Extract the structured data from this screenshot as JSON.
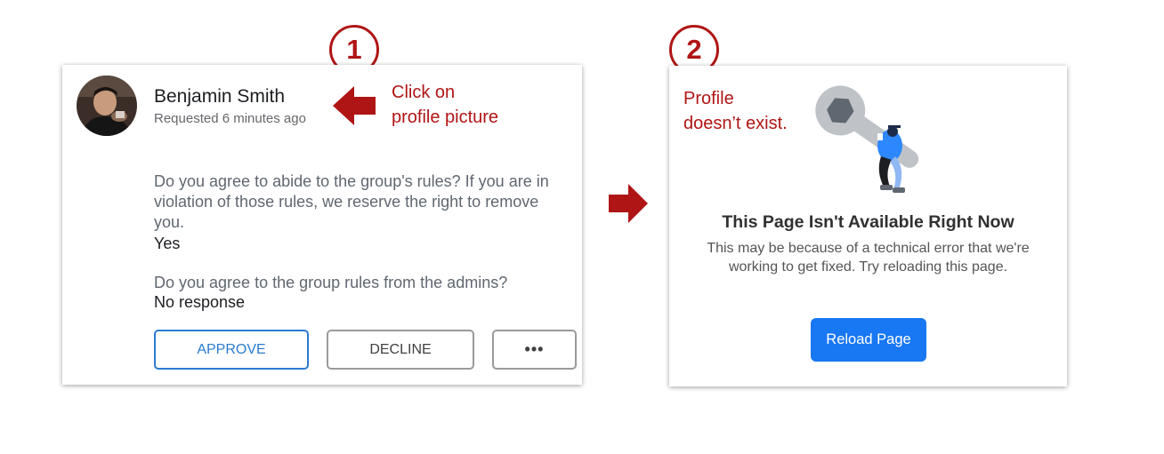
{
  "annotations": {
    "step1_number": "1",
    "step1_text": [
      "Click on",
      "profile picture"
    ],
    "step2_number": "2",
    "step2_text": [
      "Profile",
      "doesn’t exist."
    ]
  },
  "request_card": {
    "name": "Benjamin Smith",
    "requested": "Requested 6 minutes ago",
    "question1": "Do you agree to abide to the group's rules? If you are in violation of those rules, we reserve the right to remove you.",
    "answer1": "Yes",
    "question2": "Do you agree to the group rules from the admins?",
    "answer2": "No response",
    "approve_label": "APPROVE",
    "decline_label": "DECLINE",
    "more_label": "•••"
  },
  "error_page": {
    "title": "This Page Isn't Available Right Now",
    "body": "This may be because of a technical error that we're working to get fixed. Try reloading this page.",
    "reload_label": "Reload Page"
  },
  "colors": {
    "annotation_red": "#b01515",
    "approve_blue": "#2b7bd0",
    "reload_blue": "#1877f2"
  },
  "icons": [
    "profile-avatar",
    "left-pointing-arrow-icon",
    "right-pointing-arrow-icon",
    "wrench-person-illustration"
  ]
}
